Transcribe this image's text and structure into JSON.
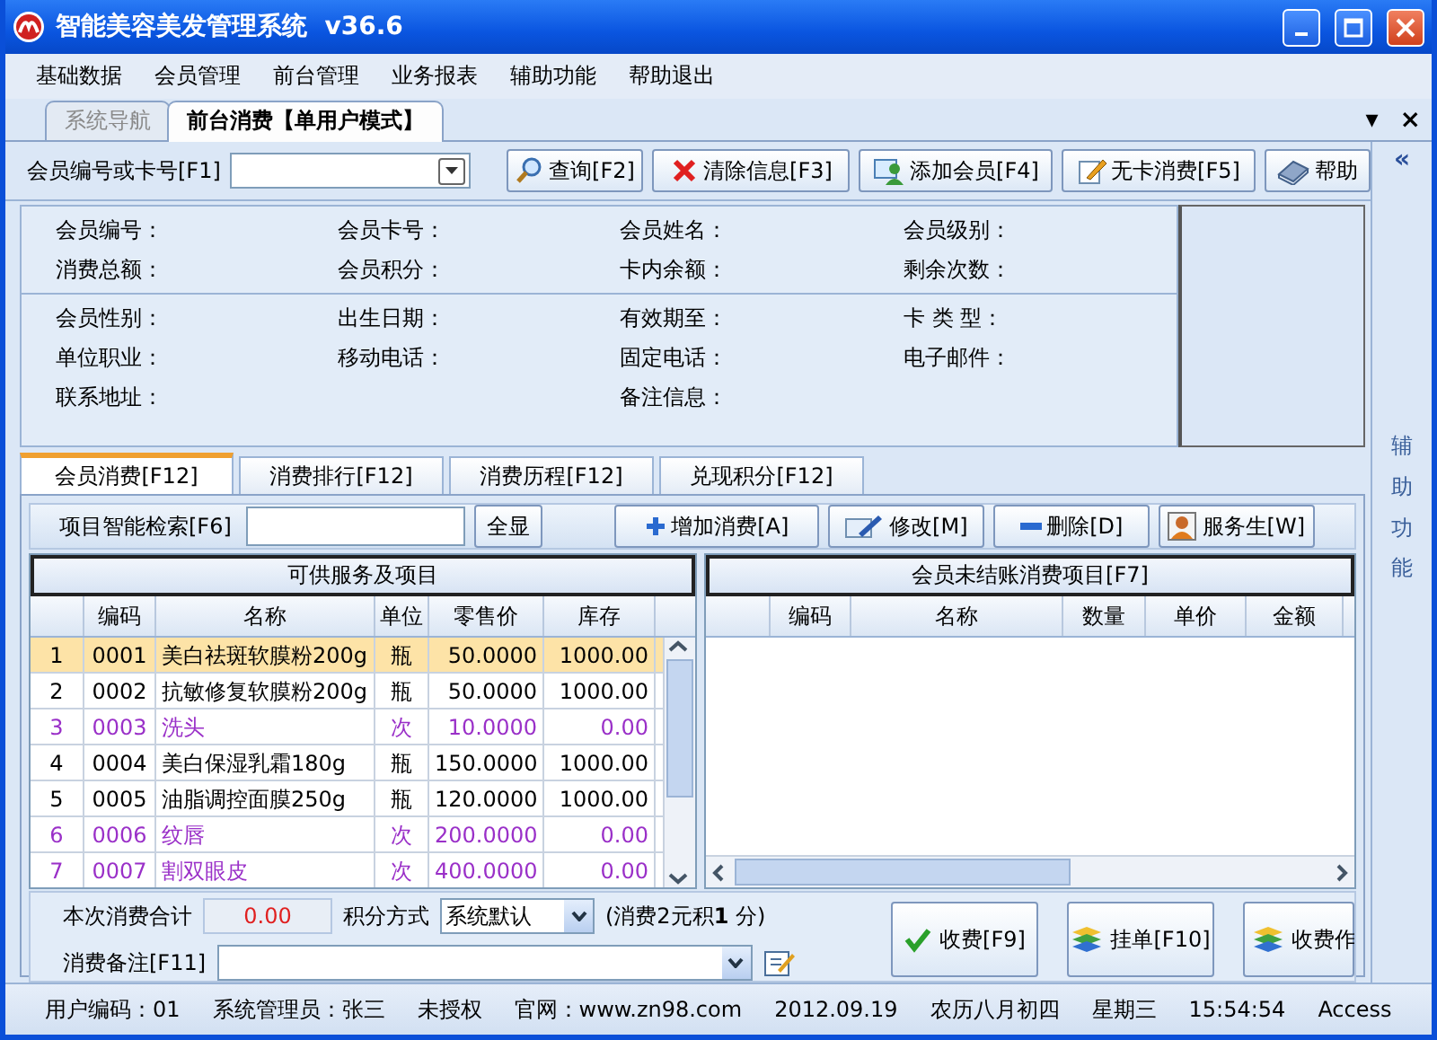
{
  "window": {
    "title": "智能美容美发管理系统  v36.6"
  },
  "menu": [
    "基础数据",
    "会员管理",
    "前台管理",
    "业务报表",
    "辅助功能",
    "帮助退出"
  ],
  "doc_tabs": [
    {
      "label": "系统导航",
      "selected": false
    },
    {
      "label": "前台消费【单用户模式】",
      "selected": true
    }
  ],
  "doc_tab_controls": [
    "▾",
    "×"
  ],
  "search": {
    "label": "会员编号或卡号[F1]",
    "buttons": [
      "查询[F2]",
      "清除信息[F3]",
      "添加会员[F4]",
      "无卡消费[F5]",
      "帮助"
    ]
  },
  "side_panel": {
    "toggle": "«",
    "label": "辅助功能"
  },
  "member_info": {
    "summary": [
      "会员编号：",
      "会员卡号：",
      "会员姓名：",
      "会员级别：",
      "消费总额：",
      "会员积分：",
      "卡内余额：",
      "剩余次数："
    ],
    "details_columns": [
      [
        "会员性别：",
        "单位职业：",
        "联系地址："
      ],
      [
        "出生日期：",
        "移动电话："
      ],
      [
        "有效期至：",
        "固定电话：",
        "备注信息："
      ],
      [
        "卡 类 型：",
        "电子邮件："
      ]
    ]
  },
  "sub_tabs": [
    {
      "label": "会员消费[F12]",
      "selected": true
    },
    {
      "label": "消费排行[F12]",
      "selected": false
    },
    {
      "label": "消费历程[F12]",
      "selected": false
    },
    {
      "label": "兑现积分[F12]",
      "selected": false
    }
  ],
  "toolbar": {
    "search_label": "项目智能检索[F6]",
    "show_all": "全显",
    "buttons": [
      "增加消费[A]",
      "修改[M]",
      "删除[D]",
      "服务生[W]"
    ]
  },
  "items_grid": {
    "title": "可供服务及项目",
    "columns": [
      "编码",
      "名称",
      "单位",
      "零售价",
      "库存"
    ],
    "rows": [
      {
        "no": "1",
        "cells": [
          "0001",
          "美白祛斑软膜粉200g",
          "瓶",
          "50.0000",
          "1000.00"
        ],
        "kind": "product",
        "selected": true
      },
      {
        "no": "2",
        "cells": [
          "0002",
          "抗敏修复软膜粉200g",
          "瓶",
          "50.0000",
          "1000.00"
        ],
        "kind": "product",
        "selected": false
      },
      {
        "no": "3",
        "cells": [
          "0003",
          "洗头",
          "次",
          "10.0000",
          "0.00"
        ],
        "kind": "service",
        "selected": false
      },
      {
        "no": "4",
        "cells": [
          "0004",
          "美白保湿乳霜180g",
          "瓶",
          "150.0000",
          "1000.00"
        ],
        "kind": "product",
        "selected": false
      },
      {
        "no": "5",
        "cells": [
          "0005",
          "油脂调控面膜250g",
          "瓶",
          "120.0000",
          "1000.00"
        ],
        "kind": "product",
        "selected": false
      },
      {
        "no": "6",
        "cells": [
          "0006",
          "纹唇",
          "次",
          "200.0000",
          "0.00"
        ],
        "kind": "service",
        "selected": false
      },
      {
        "no": "7",
        "cells": [
          "0007",
          "割双眼皮",
          "次",
          "400.0000",
          "0.00"
        ],
        "kind": "service",
        "selected": false
      }
    ]
  },
  "pending_grid": {
    "title": "会员未结账消费项目[F7]",
    "columns": [
      "编码",
      "名称",
      "数量",
      "单价",
      "金额"
    ]
  },
  "footer": {
    "total_label": "本次消费合计",
    "total": "0.00",
    "points_label": "积分方式",
    "points_method": "系统默认",
    "points_rule": "(消费2元积**1** 分)",
    "remark_label": "消费备注[F11]",
    "buttons": [
      "收费[F9]",
      "挂单[F10]",
      "收费作"
    ]
  },
  "status_bar": [
    "用户编码：01",
    "系统管理员：张三",
    "未授权",
    "官网：www.zn98.com",
    "2012.09.19",
    "农历八月初四",
    "星期三",
    "15:54:54",
    "Access"
  ]
}
